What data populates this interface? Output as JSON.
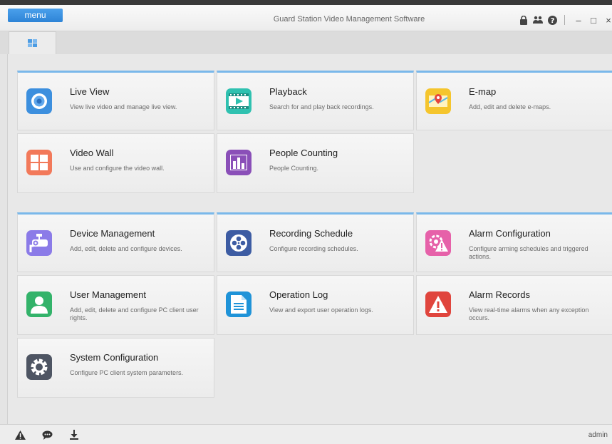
{
  "window": {
    "menu_label": "menu",
    "title": "Guard Station Video Management Software",
    "toolbar_icons": [
      "lock-icon",
      "users-icon",
      "help-icon"
    ],
    "window_controls": {
      "minimize": "–",
      "maximize": "□",
      "close": "×"
    }
  },
  "tabs": [
    {
      "icon": "home-grid-icon",
      "active": true
    }
  ],
  "groups": {
    "operation": [
      {
        "title": "Live View",
        "desc": "View live video and manage live view.",
        "icon": "live-view-icon",
        "color": "#3c8fde"
      },
      {
        "title": "Playback",
        "desc": "Search for and play back recordings.",
        "icon": "playback-icon",
        "color": "#2fc1b0"
      },
      {
        "title": "E-map",
        "desc": "Add, edit and delete e-maps.",
        "icon": "e-map-icon",
        "color": "#f5c52d"
      },
      {
        "title": "Video Wall",
        "desc": "Use and configure the video wall.",
        "icon": "video-wall-icon",
        "color": "#f2795a"
      },
      {
        "title": "People Counting",
        "desc": "People Counting.",
        "icon": "people-counting-icon",
        "color": "#8a4fb8"
      }
    ],
    "maintenance": [
      {
        "title": "Device Management",
        "desc": "Add, edit, delete and configure devices.",
        "icon": "device-management-icon",
        "color": "#8b7be8"
      },
      {
        "title": "Recording Schedule",
        "desc": "Configure recording schedules.",
        "icon": "recording-schedule-icon",
        "color": "#3d5ca3"
      },
      {
        "title": "Alarm Configuration",
        "desc": "Configure arming schedules and triggered actions.",
        "icon": "alarm-configuration-icon",
        "color": "#e661a9"
      },
      {
        "title": "User Management",
        "desc": "Add, edit, delete and configure PC client user rights.",
        "icon": "user-management-icon",
        "color": "#33b36a"
      },
      {
        "title": "Operation Log",
        "desc": "View and export user operation logs.",
        "icon": "operation-log-icon",
        "color": "#1f93d8"
      },
      {
        "title": "Alarm Records",
        "desc": "View real-time alarms when any exception occurs.",
        "icon": "alarm-records-icon",
        "color": "#e0453d"
      },
      {
        "title": "System Configuration",
        "desc": "Configure PC client system parameters.",
        "icon": "system-configuration-icon",
        "color": "#4e5563"
      }
    ]
  },
  "status": {
    "icons": [
      "alarm-icon",
      "message-icon",
      "download-icon"
    ],
    "user": "admin"
  }
}
